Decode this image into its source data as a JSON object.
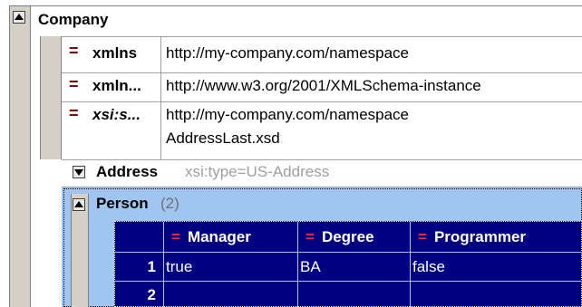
{
  "company": {
    "label": "Company"
  },
  "attributes": [
    {
      "name": "xmlns",
      "value": "http://my-company.com/namespace",
      "value2": ""
    },
    {
      "name": "xmln...",
      "value": "http://www.w3.org/2001/XMLSchema-instance",
      "value2": ""
    },
    {
      "name": "xsi:s...",
      "value": "http://my-company.com/namespace",
      "value2": "AddressLast.xsd"
    }
  ],
  "attribute_marker": "=",
  "address": {
    "label": "Address",
    "type": "xsi:type=US-Address"
  },
  "person": {
    "label": "Person",
    "count": "(2)",
    "columns": [
      "Manager",
      "Degree",
      "Programmer"
    ],
    "rows": [
      {
        "num": "1",
        "cells": [
          "true",
          "BA",
          "false"
        ]
      },
      {
        "num": "2",
        "cells": [
          "",
          "",
          ""
        ]
      }
    ]
  },
  "colors": {
    "grid_bg": "#000080",
    "person_bg": "#9fc5f0",
    "attribute_marker": "#8b0000",
    "header_marker": "#ff2a2a"
  }
}
